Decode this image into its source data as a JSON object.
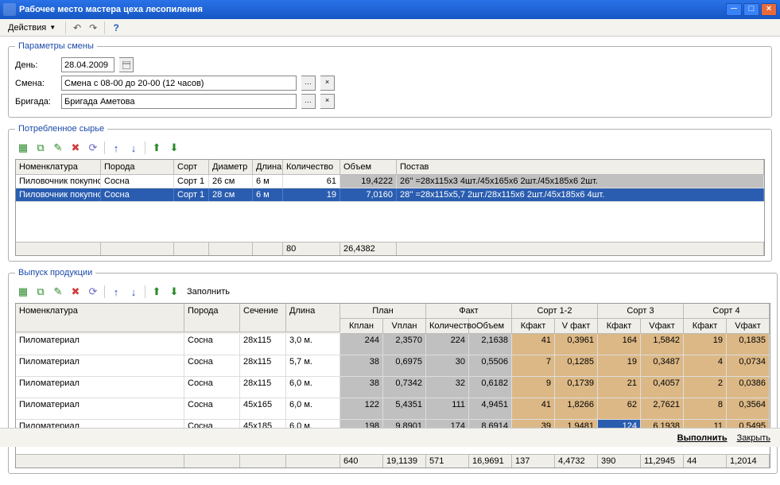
{
  "window": {
    "title": "Рабочее место мастера цеха лесопиления"
  },
  "menu": {
    "actions": "Действия"
  },
  "params": {
    "legend": "Параметры смены",
    "day_label": "День:",
    "day_value": "28.04.2009",
    "shift_label": "Смена:",
    "shift_value": "Смена с 08-00 до 20-00 (12 часов)",
    "brigade_label": "Бригада:",
    "brigade_value": "Бригада Аметова"
  },
  "consumed": {
    "legend": "Потребленное сырье",
    "headers": [
      "Номенклатура",
      "Порода",
      "Сорт",
      "Диаметр",
      "Длина",
      "Количество",
      "Объем",
      "Постав"
    ],
    "rows": [
      {
        "nom": "Пиловочник покупной",
        "por": "Сосна",
        "sort": "Сорт 1",
        "diam": "26 см",
        "len": "6 м",
        "qty": "61",
        "vol": "19,4222",
        "post": "26'' =28x115x3 4шт./45x165x6 2шт./45x185x6 2шт."
      },
      {
        "nom": "Пиловочник покупной",
        "por": "Сосна",
        "sort": "Сорт 1",
        "diam": "28 см",
        "len": "6 м",
        "qty": "19",
        "vol": "7,0160",
        "post": "28'' =28x115x5,7 2шт./28x115x6 2шт./45x185x6 4шт."
      }
    ],
    "foot": {
      "qty": "80",
      "vol": "26,4382"
    }
  },
  "output": {
    "legend": "Выпуск продукции",
    "fill_label": "Заполнить",
    "headers_top": [
      "Номенклатура",
      "Порода",
      "Сечение",
      "Длина",
      "План",
      "Факт",
      "Сорт 1-2",
      "Сорт 3",
      "Сорт 4"
    ],
    "headers_sub": [
      "Кплан",
      "Vплан",
      "Количество",
      "Объем",
      "Кфакт",
      "V факт",
      "Кфакт",
      "Vфакт",
      "Кфакт",
      "Vфакт"
    ],
    "rows": [
      {
        "nom": "Пиломатериал",
        "por": "Сосна",
        "sec": "28x115",
        "dl": "3,0 м.",
        "kp": "244",
        "vp": "2,3570",
        "kf": "224",
        "vf": "2,1638",
        "k12": "41",
        "v12": "0,3961",
        "k3": "164",
        "v3": "1,5842",
        "k4": "19",
        "v4": "0,1835"
      },
      {
        "nom": "Пиломатериал",
        "por": "Сосна",
        "sec": "28x115",
        "dl": "5,7 м.",
        "kp": "38",
        "vp": "0,6975",
        "kf": "30",
        "vf": "0,5506",
        "k12": "7",
        "v12": "0,1285",
        "k3": "19",
        "v3": "0,3487",
        "k4": "4",
        "v4": "0,0734"
      },
      {
        "nom": "Пиломатериал",
        "por": "Сосна",
        "sec": "28x115",
        "dl": "6,0 м.",
        "kp": "38",
        "vp": "0,7342",
        "kf": "32",
        "vf": "0,6182",
        "k12": "9",
        "v12": "0,1739",
        "k3": "21",
        "v3": "0,4057",
        "k4": "2",
        "v4": "0,0386"
      },
      {
        "nom": "Пиломатериал",
        "por": "Сосна",
        "sec": "45x165",
        "dl": "6,0 м.",
        "kp": "122",
        "vp": "5,4351",
        "kf": "111",
        "vf": "4,9451",
        "k12": "41",
        "v12": "1,8266",
        "k3": "62",
        "v3": "2,7621",
        "k4": "8",
        "v4": "0,3564"
      },
      {
        "nom": "Пиломатериал",
        "por": "Сосна",
        "sec": "45x185",
        "dl": "6,0 м.",
        "kp": "198",
        "vp": "9,8901",
        "kf": "174",
        "vf": "8,6914",
        "k12": "39",
        "v12": "1,9481",
        "k3": "124",
        "v3": "6,1938",
        "k4": "11",
        "v4": "0,5495"
      }
    ],
    "foot": {
      "kp": "640",
      "vp": "19,1139",
      "kf": "571",
      "vf": "16,9691",
      "k12": "137",
      "v12": "4,4732",
      "k3": "390",
      "v3": "11,2945",
      "k4": "44",
      "v4": "1,2014"
    }
  },
  "bottom": {
    "execute": "Выполнить",
    "close": "Закрыть"
  }
}
